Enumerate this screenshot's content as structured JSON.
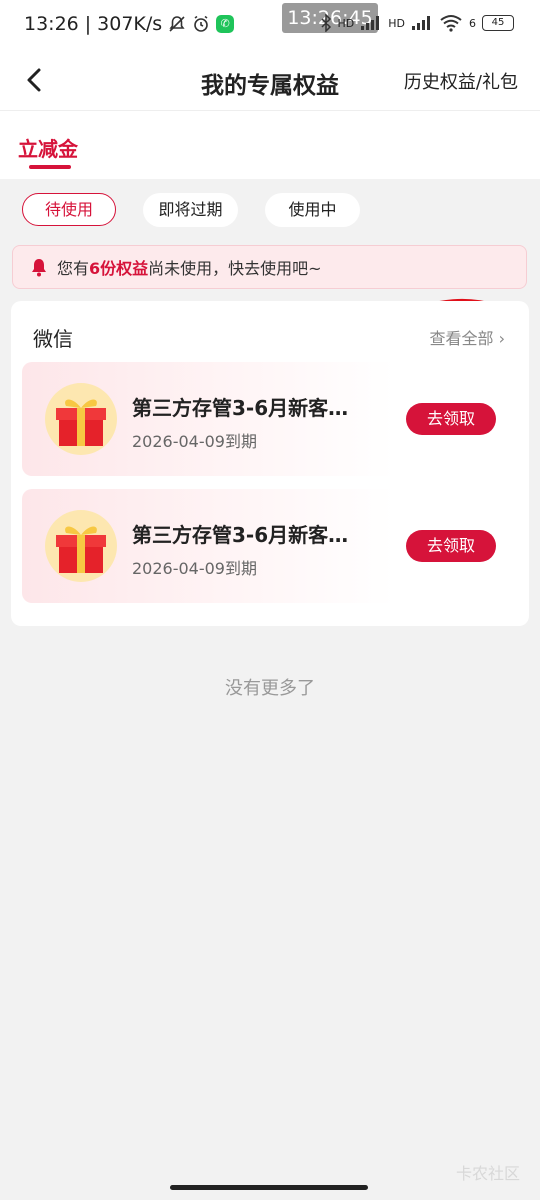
{
  "statusbar": {
    "time": "13:26",
    "speed": "307K/s",
    "clock_overlay": "13:26:45",
    "signal_1": "HD",
    "signal_2": "HD",
    "wifi_badge": "6",
    "battery": "45",
    "icons": [
      "bell-off-icon",
      "alarm-icon",
      "call-icon",
      "bluetooth-icon",
      "signal-icon",
      "wifi-icon",
      "battery-icon"
    ]
  },
  "header": {
    "title": "我的专属权益",
    "history_link": "历史权益/礼包"
  },
  "tabs": {
    "active": "立减金"
  },
  "filters": [
    "待使用",
    "即将过期",
    "使用中"
  ],
  "notice": {
    "prefix": "您有",
    "highlight": "6份权益",
    "suffix": "尚未使用，快去使用吧~"
  },
  "card": {
    "title": "微信",
    "view_all": "查看全部"
  },
  "coupons": [
    {
      "name": "第三方存管3-6月新客…",
      "expiry": "2026-04-09到期",
      "button": "去领取"
    },
    {
      "name": "第三方存管3-6月新客…",
      "expiry": "2026-04-09到期",
      "button": "去领取"
    }
  ],
  "footer": {
    "no_more": "没有更多了"
  },
  "watermark": "卡农社区",
  "colors": {
    "accent": "#d6133a",
    "notice_bg": "#fdeaec",
    "annotation": "#e0101a"
  }
}
